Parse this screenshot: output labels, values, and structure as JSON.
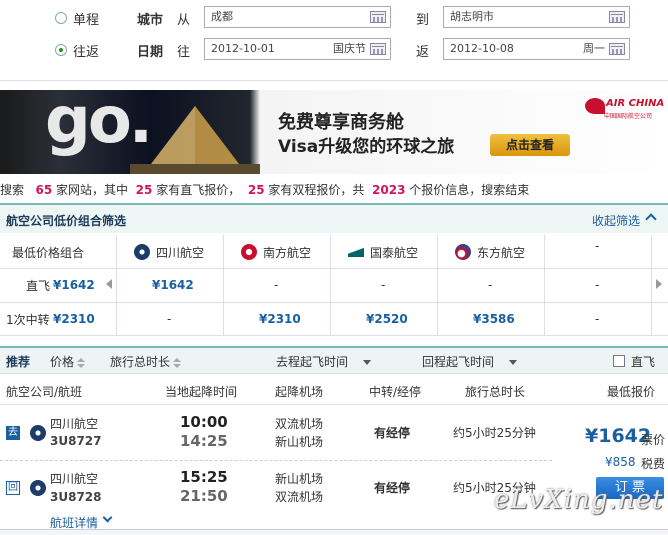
{
  "search": {
    "trip_oneway": "单程",
    "trip_round": "往返",
    "city_label": "城市",
    "from_label": "从",
    "from_city": "成都",
    "to_label": "到",
    "to_city": "胡志明市",
    "date_label": "日期",
    "depart_label": "往",
    "depart_date": "2012-10-01",
    "depart_note": "国庆节",
    "return_label": "返",
    "return_date": "2012-10-08",
    "return_note": "周一"
  },
  "banner": {
    "go_text": "go.",
    "headline": "免费尊享商务舱",
    "subline": "Visa升级您的环球之旅",
    "cta": "点击查看",
    "airline_brand": "AIR CHINA",
    "airline_cn": "中国国际航空公司"
  },
  "summary": {
    "p1": "搜索",
    "sites": "65",
    "p2": "家网站，其中",
    "direct": "25",
    "p3": "家有直飞报价，",
    "double": "25",
    "p4": "家有双程报价，共",
    "total": "2023",
    "p5": "个报价信息，搜索结束"
  },
  "filter": {
    "title": "航空公司低价组合筛选",
    "collapse": "收起筛选",
    "row_header": "最低价格组合",
    "airlines": [
      "四川航空",
      "南方航空",
      "国泰航空",
      "东方航空"
    ],
    "dash": "-",
    "rows": [
      {
        "label": "直飞",
        "best": "¥1642",
        "cells": [
          "¥1642",
          "-",
          "-",
          "-",
          "-"
        ]
      },
      {
        "label": "1次中转",
        "best": "¥2310",
        "cells": [
          "-",
          "¥2310",
          "¥2520",
          "¥3586",
          "-"
        ]
      }
    ]
  },
  "sort": {
    "recommend": "推荐",
    "price": "价格",
    "duration": "旅行总时长",
    "out_time": "去程起飞时间",
    "ret_time": "回程起飞时间",
    "direct": "直飞"
  },
  "columns": [
    "航空公司/航班",
    "当地起降时间",
    "起降机场",
    "中转/经停",
    "旅行总时长",
    "最低报价"
  ],
  "flights": [
    {
      "tag": "去",
      "airline": "四川航空",
      "no": "3U8727",
      "dep": "10:00",
      "arr": "14:25",
      "ap1": "双流机场",
      "ap2": "新山机场",
      "stop": "有经停",
      "dur": "约5小时25分钟"
    },
    {
      "tag": "回",
      "airline": "四川航空",
      "no": "3U8728",
      "dep": "15:25",
      "arr": "21:50",
      "ap1": "新山机场",
      "ap2": "双流机场",
      "stop": "有经停",
      "dur": "约5小时25分钟"
    }
  ],
  "offer": {
    "price": "¥1642",
    "price_label": "票价",
    "tax": "¥858",
    "tax_label": "税费",
    "book": "订  票"
  },
  "details": "航班详情",
  "watermark": "eLvXing.net",
  "colors": {
    "accent": "#1a5fa0",
    "highlight": "#d4145a",
    "teal": "#7bbab7"
  }
}
